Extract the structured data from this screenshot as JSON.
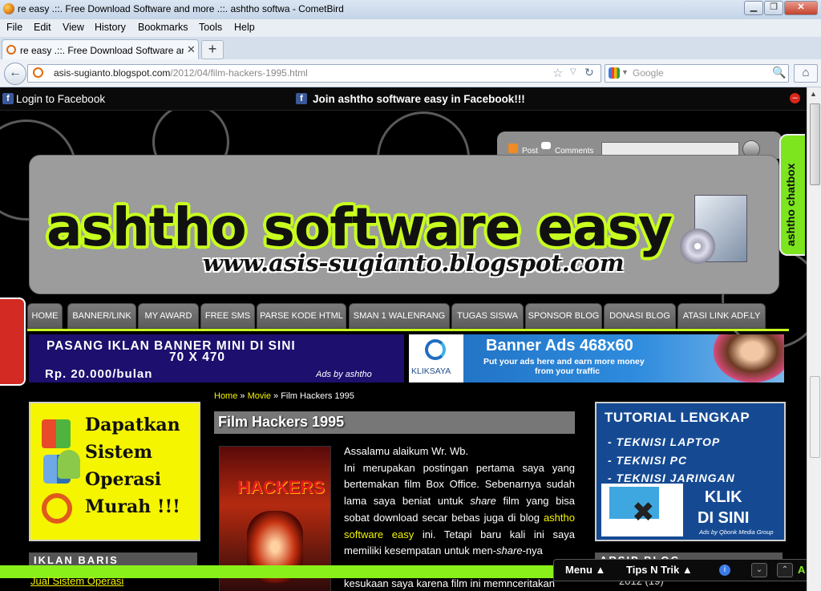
{
  "window": {
    "title": "re easy .::. Free Download Software and more .::. ashtho softwa - CometBird",
    "minimize": "▁",
    "maximize": "❐",
    "close": "✕"
  },
  "menubar": {
    "items": [
      "File",
      "Edit",
      "View",
      "History",
      "Bookmarks",
      "Tools",
      "Help"
    ]
  },
  "tabs": [
    {
      "label": "re easy .::. Free Download Software an...",
      "close": "✕"
    }
  ],
  "newtab": "+",
  "navigation": {
    "back": "←",
    "url_domain": "asis-sugianto.blogspot.com",
    "url_path": "/2012/04/film-hackers-1995.html",
    "star": "☆",
    "dropdown": "▽",
    "reload": "↻",
    "search_placeholder": "Google",
    "search_glyph": "🔍",
    "home": "⌂"
  },
  "facebook_bar": {
    "icon": "f",
    "left_text": "Login to Facebook",
    "center_text": "Join ashtho software easy in Facebook!!!",
    "close": "–"
  },
  "header": {
    "post_label": "Post",
    "comments_label": "Comments",
    "logo_text": "ashtho software easy",
    "logo_url": "www.asis-sugianto.blogspot.com",
    "chatbox_label": "ashtho chatbox"
  },
  "nav_menu": [
    "HOME",
    "BANNER/LINK",
    "MY AWARD",
    "FREE SMS",
    "PARSE KODE HTML",
    "SMAN 1 WALENRANG",
    "TUGAS SISWA",
    "SPONSOR BLOG",
    "DONASI BLOG",
    "ATASI LINK ADF.LY"
  ],
  "banner_left": {
    "line1": "PASANG IKLAN BANNER MINI DI SINI",
    "line2": "70 X 470",
    "line3": "Rp. 20.000/bulan",
    "by": "Ads by ashtho"
  },
  "banner_right": {
    "brand": "KLIKSAYA",
    "heading": "Banner Ads 468x60",
    "sub1": "Put your ads here and earn more money",
    "sub2": "from your traffic"
  },
  "left_ad": {
    "lines": [
      "Dapatkan",
      "Sistem",
      "Operasi",
      "Murah !!!"
    ]
  },
  "left_widget": {
    "title": "IKLAN BARIS",
    "link": "Jual Sistem Operasi"
  },
  "breadcrumb": {
    "home": "Home",
    "sep": "»",
    "category": "Movie",
    "current": "Film Hackers 1995"
  },
  "post": {
    "title": "Film Hackers 1995",
    "poster_title": "HACKERS",
    "greeting": "Assalamu alaikum Wr. Wb.",
    "p1": "Ini merupakan postingan pertama saya yang bertemakan film Box Office. Sebenarnya sudah lama saya beniat untuk",
    "p1_em": "share",
    "p1b": "film yang bisa sobat download secar bebas juga di blog",
    "p1_link": "ashtho software easy",
    "p1c": "ini. Tetapi baru kali ini saya memiliki kesempatan untuk men-",
    "p1_em2": "share",
    "p1d": "-nya",
    "p2": "kesukaan saya karena film ini memnceritakan"
  },
  "right_ad": {
    "title": "TUTORIAL LENGKAP",
    "items": [
      "- TEKNISI LAPTOP",
      "- TEKNISI PC",
      "- TEKNISI JARINGAN"
    ],
    "cta1": "KLIK",
    "cta2": "DI SINI",
    "footer": "Ads by Qbonk Media Group"
  },
  "right_widget": {
    "title": "ARSIP BLOG",
    "year": "2012 (19)"
  },
  "bottom_panel": {
    "menu": "Menu ▲",
    "tips": "Tips N Trik ▲",
    "info": "i",
    "down": "⌄",
    "up": "⌃",
    "tail": "A"
  },
  "colors": {
    "accent_green": "#c8ff20",
    "bar_green": "#8af01a",
    "link_yellow": "#f5f500",
    "fb_blue": "#3b5998"
  }
}
